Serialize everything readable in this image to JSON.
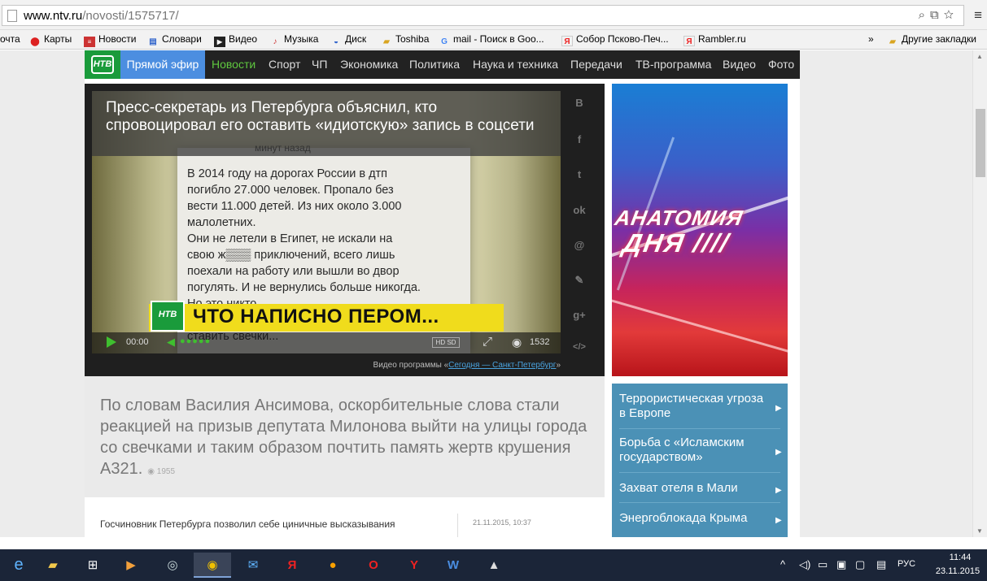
{
  "browser": {
    "url_host": "www.ntv.ru",
    "url_path": "/novosti/1575717/",
    "menu_icon": "hamburger-icon"
  },
  "bookmarks": [
    {
      "label": "очта",
      "icon": ""
    },
    {
      "label": "Карты",
      "icon": "map-pin-icon"
    },
    {
      "label": "Новости",
      "icon": "news-icon"
    },
    {
      "label": "Словари",
      "icon": "dictionary-icon"
    },
    {
      "label": "Видео",
      "icon": "video-icon"
    },
    {
      "label": "Музыка",
      "icon": "music-icon"
    },
    {
      "label": "Диск",
      "icon": "disk-icon"
    },
    {
      "label": "Toshiba",
      "icon": "folder-icon"
    },
    {
      "label": "mail - Поиск в Goo...",
      "icon": "google-icon"
    },
    {
      "label": "Собор Псково-Печ...",
      "icon": "yandex-icon"
    },
    {
      "label": "Rambler.ru",
      "icon": "yandex-icon"
    },
    {
      "label": "»",
      "icon": ""
    },
    {
      "label": "Другие закладки",
      "icon": "folder-icon"
    }
  ],
  "nav": {
    "logo": "НТВ",
    "live": "Прямой эфир",
    "items": [
      "Новости",
      "Спорт",
      "ЧП",
      "Экономика",
      "Политика",
      "Наука и техника",
      "Передачи",
      "ТВ-программа",
      "Видео",
      "Фото"
    ]
  },
  "video": {
    "title": "Пресс-секретарь из Петербурга объяснил, кто спровоцировал его оставить «идиотскую» запись в соцсети",
    "minut": "минут назад",
    "paper_text": "В 2014 году на дорогах России в дтп\nпогибло 27.000 человек. Пропало без\nвести 11.000 детей. Из них около 3.000\nмалолетних.\nОни не летели в Египет, не искали на\nсвою ж▒▒▒ приключений, всего лишь\nпоехали на работу или вышли во двор\nпогулять. И не вернулись больше никогда.\nНо это никто...\nдавай нацеплять черные ленточки,\nставить свечки...",
    "banner_logo": "НТВ",
    "banner": "ЧТО НАПИСНО ПЕРОМ...",
    "time": "00:00",
    "hd": "HD SD",
    "views": "1532",
    "caption_prefix": "Видео программы «",
    "caption_link": "Сегодня — Санкт-Петербург",
    "caption_suffix": "»"
  },
  "share": [
    "В",
    "f",
    "t",
    "ok",
    "@",
    "✎",
    "g+",
    "</>"
  ],
  "quote": {
    "text": "По словам Василия Ансимова, оскорбительные слова стали реакцией на призыв депутата Милонова выйти на улицы города со свечками и таким образом почтить память жертв крушения А321.",
    "views": "1955"
  },
  "related": {
    "title": "Госчиновник Петербурга позволил себе циничные высказывания",
    "date": "21.11.2015, 10:37"
  },
  "ad": {
    "line1": "АНАТОМИЯ",
    "line2": "ДНЯ ////"
  },
  "topics": [
    "Террористическая угроза в Европе",
    "Борьба с «Исламским государством»",
    "Захват отеля в Мали",
    "Энергоблокада Крыма"
  ],
  "taskbar": {
    "lang": "РУС",
    "time": "11:44",
    "date": "23.11.2015"
  },
  "colors": {
    "ntv_green": "#1a9b3b",
    "live_blue": "#4c8ee0",
    "nav_active": "#5fc83f",
    "topics_bg": "#4b91b6",
    "banner_yellow": "#f0dc1c"
  }
}
